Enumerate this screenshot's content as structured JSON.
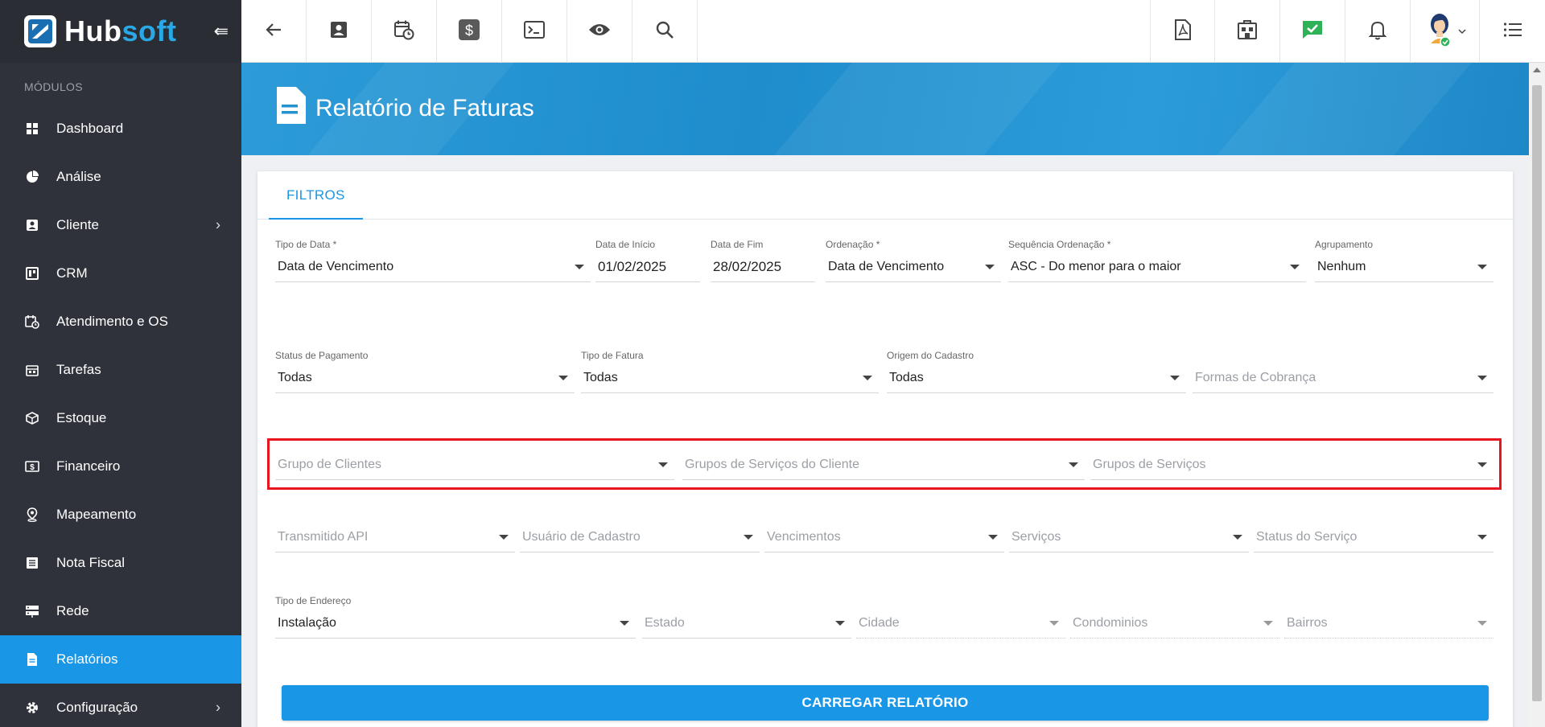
{
  "brand": {
    "name_part1": "Hub",
    "name_part2": "soft",
    "accent": "#1a96e6"
  },
  "sidebar": {
    "section_label": "MÓDULOS",
    "items": [
      {
        "label": "Dashboard",
        "icon": "dashboard-icon",
        "has_submenu": false
      },
      {
        "label": "Análise",
        "icon": "pie-chart-icon",
        "has_submenu": false
      },
      {
        "label": "Cliente",
        "icon": "contact-card-icon",
        "has_submenu": true
      },
      {
        "label": "CRM",
        "icon": "crm-board-icon",
        "has_submenu": false
      },
      {
        "label": "Atendimento e OS",
        "icon": "calendar-clock-icon",
        "has_submenu": false
      },
      {
        "label": "Tarefas",
        "icon": "calendar-tasks-icon",
        "has_submenu": false
      },
      {
        "label": "Estoque",
        "icon": "box-icon",
        "has_submenu": false
      },
      {
        "label": "Financeiro",
        "icon": "money-icon",
        "has_submenu": false
      },
      {
        "label": "Mapeamento",
        "icon": "map-pin-icon",
        "has_submenu": false
      },
      {
        "label": "Nota Fiscal",
        "icon": "receipt-icon",
        "has_submenu": false
      },
      {
        "label": "Rede",
        "icon": "server-icon",
        "has_submenu": false
      },
      {
        "label": "Relatórios",
        "icon": "report-icon",
        "has_submenu": false,
        "active": true
      },
      {
        "label": "Configuração",
        "icon": "gear-icon",
        "has_submenu": true
      }
    ]
  },
  "topbar": {
    "left_icons": [
      "back-arrow-icon",
      "contact-card-icon",
      "calendar-clock-icon",
      "dollar-icon",
      "terminal-icon",
      "eye-icon",
      "search-icon"
    ],
    "right_icons": [
      "pdf-icon",
      "building-icon",
      "chat-check-icon",
      "bell-icon",
      "avatar",
      "menu-list-icon"
    ]
  },
  "page": {
    "title": "Relatório de Faturas"
  },
  "tabs": [
    {
      "label": "FILTROS",
      "active": true
    }
  ],
  "filters": {
    "tipo_data": {
      "label": "Tipo de Data *",
      "value": "Data de Vencimento"
    },
    "data_inicio": {
      "label": "Data de Início",
      "value": "01/02/2025"
    },
    "data_fim": {
      "label": "Data de Fim",
      "value": "28/02/2025"
    },
    "ordenacao": {
      "label": "Ordenação *",
      "value": "Data de Vencimento"
    },
    "sequencia": {
      "label": "Sequência Ordenação *",
      "value": "ASC - Do menor para o maior"
    },
    "agrupamento": {
      "label": "Agrupamento",
      "value": "Nenhum"
    },
    "status_pagamento": {
      "label": "Status de Pagamento",
      "value": "Todas"
    },
    "tipo_fatura": {
      "label": "Tipo de Fatura",
      "value": "Todas"
    },
    "origem_cadastro": {
      "label": "Origem do Cadastro",
      "value": "Todas"
    },
    "formas_cobranca": {
      "placeholder": "Formas de Cobrança"
    },
    "grupo_clientes": {
      "placeholder": "Grupo de Clientes"
    },
    "grupos_servicos_cliente": {
      "placeholder": "Grupos de Serviços do Cliente"
    },
    "grupos_servicos": {
      "placeholder": "Grupos de Serviços"
    },
    "transmitido_api": {
      "placeholder": "Transmitido API"
    },
    "usuario_cadastro": {
      "placeholder": "Usuário de Cadastro"
    },
    "vencimentos": {
      "placeholder": "Vencimentos"
    },
    "servicos": {
      "placeholder": "Serviços"
    },
    "status_servico": {
      "placeholder": "Status do Serviço"
    },
    "tipo_endereco": {
      "label": "Tipo de Endereço",
      "value": "Instalação"
    },
    "estado": {
      "placeholder": "Estado"
    },
    "cidade": {
      "placeholder": "Cidade"
    },
    "condominios": {
      "placeholder": "Condominios"
    },
    "bairros": {
      "placeholder": "Bairros"
    }
  },
  "actions": {
    "load_report": "CARREGAR RELATÓRIO"
  }
}
